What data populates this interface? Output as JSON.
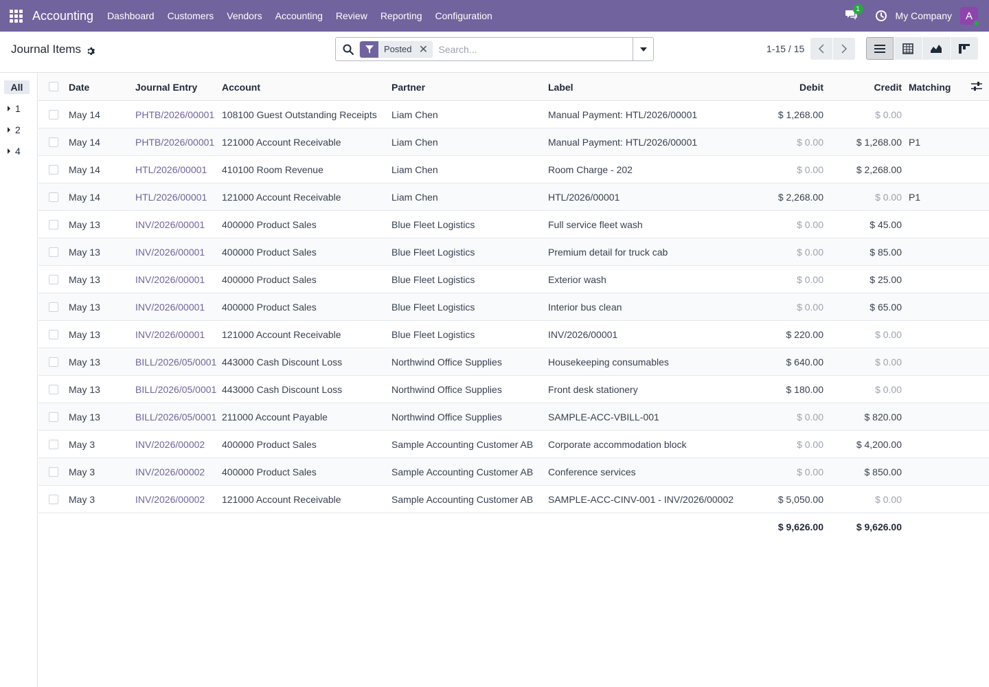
{
  "navbar": {
    "brand": "Accounting",
    "menu": [
      "Dashboard",
      "Customers",
      "Vendors",
      "Accounting",
      "Review",
      "Reporting",
      "Configuration"
    ],
    "chat_count": "1",
    "company": "My Company",
    "avatar_letter": "A",
    "accent": "#71639e"
  },
  "control": {
    "title": "Journal Items",
    "facet": "Posted",
    "search_placeholder": "Search...",
    "pager": "1-15 / 15"
  },
  "side": {
    "all": "All",
    "groups": [
      "1",
      "2",
      "4"
    ]
  },
  "table": {
    "headers": {
      "date": "Date",
      "journal_entry": "Journal Entry",
      "account": "Account",
      "partner": "Partner",
      "label": "Label",
      "debit": "Debit",
      "credit": "Credit",
      "matching": "Matching"
    },
    "rows": [
      {
        "date": "May 14",
        "entry": "PHTB/2026/00001",
        "account": "108100 Guest Outstanding Receipts",
        "partner": "Liam Chen",
        "label": "Manual Payment: HTL/2026/00001",
        "debit": "$ 1,268.00",
        "credit": "$ 0.00",
        "matching": ""
      },
      {
        "date": "May 14",
        "entry": "PHTB/2026/00001",
        "account": "121000 Account Receivable",
        "partner": "Liam Chen",
        "label": "Manual Payment: HTL/2026/00001",
        "debit": "$ 0.00",
        "credit": "$ 1,268.00",
        "matching": "P1"
      },
      {
        "date": "May 14",
        "entry": "HTL/2026/00001",
        "account": "410100 Room Revenue",
        "partner": "Liam Chen",
        "label": "Room Charge - 202",
        "debit": "$ 0.00",
        "credit": "$ 2,268.00",
        "matching": ""
      },
      {
        "date": "May 14",
        "entry": "HTL/2026/00001",
        "account": "121000 Account Receivable",
        "partner": "Liam Chen",
        "label": "HTL/2026/00001",
        "debit": "$ 2,268.00",
        "credit": "$ 0.00",
        "matching": "P1"
      },
      {
        "date": "May 13",
        "entry": "INV/2026/00001",
        "account": "400000 Product Sales",
        "partner": "Blue Fleet Logistics",
        "label": "Full service fleet wash",
        "debit": "$ 0.00",
        "credit": "$ 45.00",
        "matching": ""
      },
      {
        "date": "May 13",
        "entry": "INV/2026/00001",
        "account": "400000 Product Sales",
        "partner": "Blue Fleet Logistics",
        "label": "Premium detail for truck cab",
        "debit": "$ 0.00",
        "credit": "$ 85.00",
        "matching": ""
      },
      {
        "date": "May 13",
        "entry": "INV/2026/00001",
        "account": "400000 Product Sales",
        "partner": "Blue Fleet Logistics",
        "label": "Exterior wash",
        "debit": "$ 0.00",
        "credit": "$ 25.00",
        "matching": ""
      },
      {
        "date": "May 13",
        "entry": "INV/2026/00001",
        "account": "400000 Product Sales",
        "partner": "Blue Fleet Logistics",
        "label": "Interior bus clean",
        "debit": "$ 0.00",
        "credit": "$ 65.00",
        "matching": ""
      },
      {
        "date": "May 13",
        "entry": "INV/2026/00001",
        "account": "121000 Account Receivable",
        "partner": "Blue Fleet Logistics",
        "label": "INV/2026/00001",
        "debit": "$ 220.00",
        "credit": "$ 0.00",
        "matching": ""
      },
      {
        "date": "May 13",
        "entry": "BILL/2026/05/0001",
        "account": "443000 Cash Discount Loss",
        "partner": "Northwind Office Supplies",
        "label": "Housekeeping consumables",
        "debit": "$ 640.00",
        "credit": "$ 0.00",
        "matching": ""
      },
      {
        "date": "May 13",
        "entry": "BILL/2026/05/0001",
        "account": "443000 Cash Discount Loss",
        "partner": "Northwind Office Supplies",
        "label": "Front desk stationery",
        "debit": "$ 180.00",
        "credit": "$ 0.00",
        "matching": ""
      },
      {
        "date": "May 13",
        "entry": "BILL/2026/05/0001",
        "account": "211000 Account Payable",
        "partner": "Northwind Office Supplies",
        "label": "SAMPLE-ACC-VBILL-001",
        "debit": "$ 0.00",
        "credit": "$ 820.00",
        "matching": ""
      },
      {
        "date": "May 3",
        "entry": "INV/2026/00002",
        "account": "400000 Product Sales",
        "partner": "Sample Accounting Customer AB",
        "label": "Corporate accommodation block",
        "debit": "$ 0.00",
        "credit": "$ 4,200.00",
        "matching": ""
      },
      {
        "date": "May 3",
        "entry": "INV/2026/00002",
        "account": "400000 Product Sales",
        "partner": "Sample Accounting Customer AB",
        "label": "Conference services",
        "debit": "$ 0.00",
        "credit": "$ 850.00",
        "matching": ""
      },
      {
        "date": "May 3",
        "entry": "INV/2026/00002",
        "account": "121000 Account Receivable",
        "partner": "Sample Accounting Customer AB",
        "label": "SAMPLE-ACC-CINV-001 - INV/2026/00002",
        "debit": "$ 5,050.00",
        "credit": "$ 0.00",
        "matching": ""
      }
    ],
    "totals": {
      "debit": "$ 9,626.00",
      "credit": "$ 9,626.00"
    }
  }
}
